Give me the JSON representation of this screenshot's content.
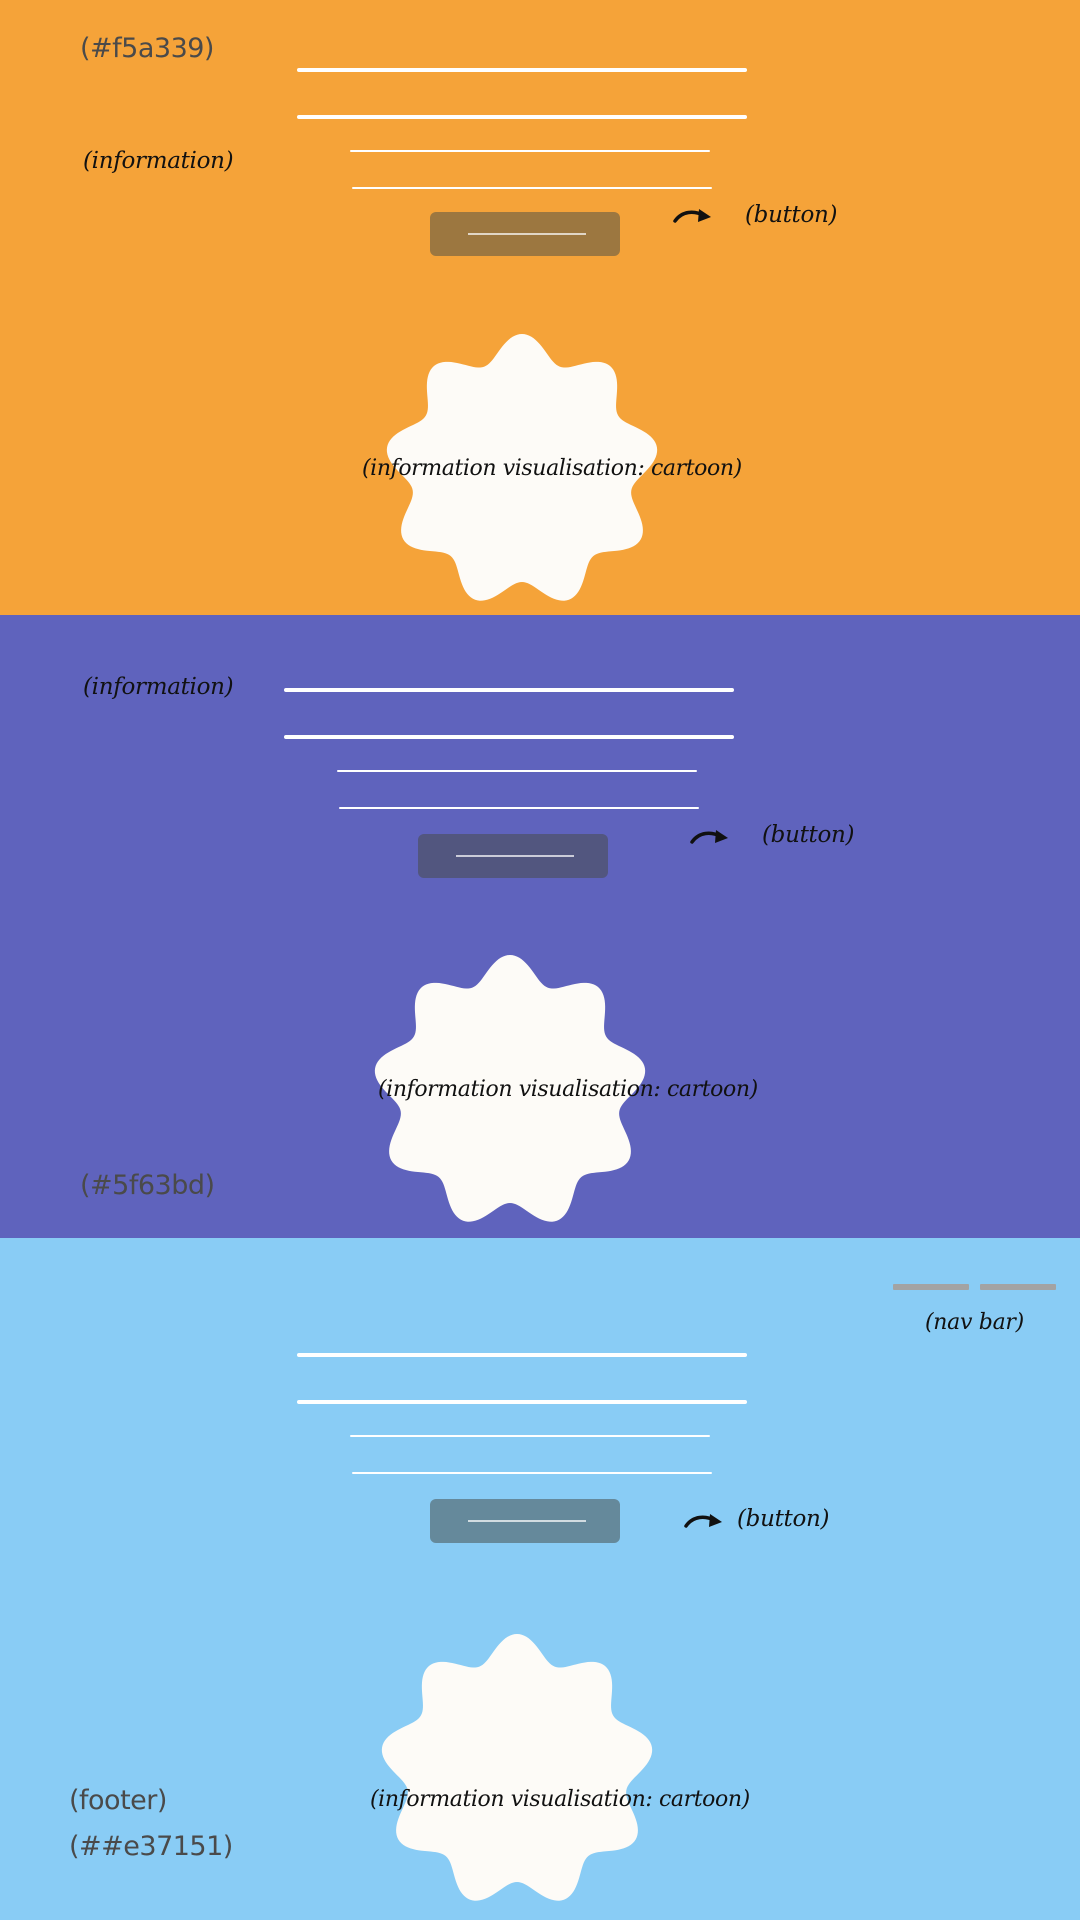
{
  "sections": [
    {
      "color": "#f5a339",
      "hex_label": "(#f5a339)",
      "info_label": "(information)",
      "button_label": "(button)",
      "button_color": "#9c7740",
      "visualisation_label": "(information visualisation: cartoon)"
    },
    {
      "color": "#5f63bd",
      "hex_label": "(#5f63bd)",
      "info_label": "(information)",
      "button_label": "(button)",
      "button_color": "#52567f",
      "visualisation_label": "(information visualisation: cartoon)"
    },
    {
      "color": "#89ccf5",
      "nav_label": "(nav bar)",
      "nav_color": "#a3a3a3",
      "button_label": "(button)",
      "button_color": "#65899b",
      "visualisation_label": "(information visualisation: cartoon)",
      "footer_label": "(footer)",
      "footer_hex_label": "(##e37151)"
    }
  ],
  "badge_color": "#fdfbf7",
  "icons": {
    "arrow": "curved-arrow-right-icon",
    "badge": "scalloped-circle-icon"
  }
}
